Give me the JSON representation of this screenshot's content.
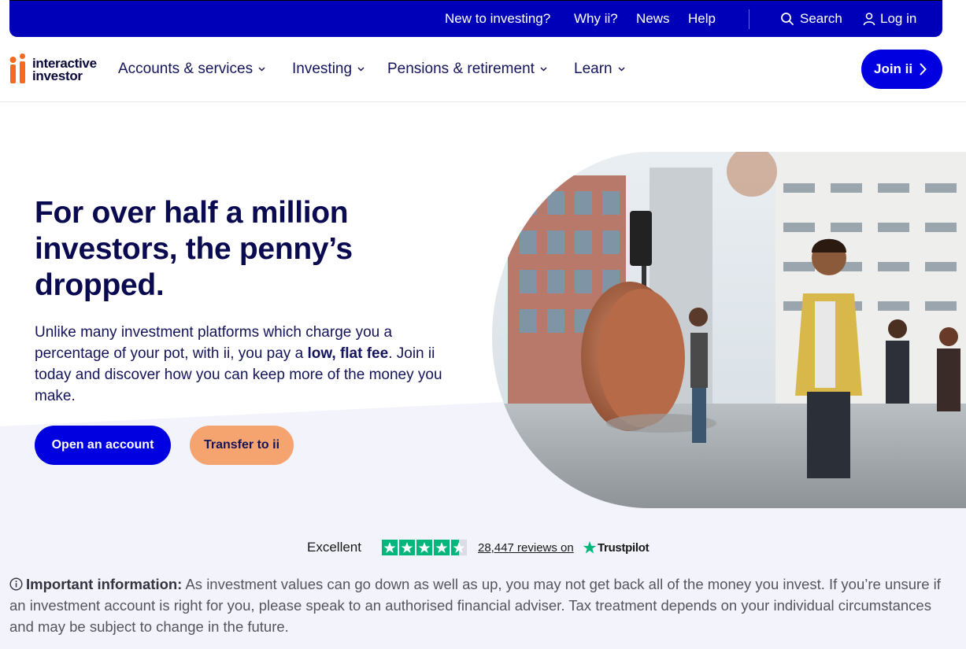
{
  "utility_nav": {
    "links": [
      "New to investing?",
      "Why ii?",
      "News",
      "Help"
    ],
    "search_label": "Search",
    "login_label": "Log in"
  },
  "main_nav": {
    "logo_line1": "interactive",
    "logo_line2": "investor",
    "items": [
      "Accounts & services",
      "Investing",
      "Pensions & retirement",
      "Learn"
    ],
    "join_label": "Join ii"
  },
  "hero": {
    "title": "For over half a million investors, the penny’s dropped.",
    "body_part1": "Unlike many investment platforms which charge you a percentage of your pot, with ii, you pay a ",
    "body_bold": "low, flat fee",
    "body_part2": ". Join ii today and discover how you can keep more of the money you make.",
    "primary_button": "Open an account",
    "secondary_button": "Transfer to ii"
  },
  "trustpilot": {
    "rating_label": "Excellent",
    "stars": 4.5,
    "reviews_text": "28,447 reviews on",
    "brand": "Trustpilot"
  },
  "important_info": {
    "heading": "Important information:",
    "text": " As investment values can go down as well as up, you may not get back all of the money you invest. If you’re unsure if an investment account is right for you, please speak to an authorised financial adviser. Tax treatment depends on your individual circumstances and may be subject to change in the future."
  },
  "colors": {
    "brand_blue": "#0000e0",
    "utility_bar": "#0000b8",
    "orange": "#f5a36f",
    "navy_text": "#0a0a50",
    "trustpilot_green": "#00b67a"
  }
}
